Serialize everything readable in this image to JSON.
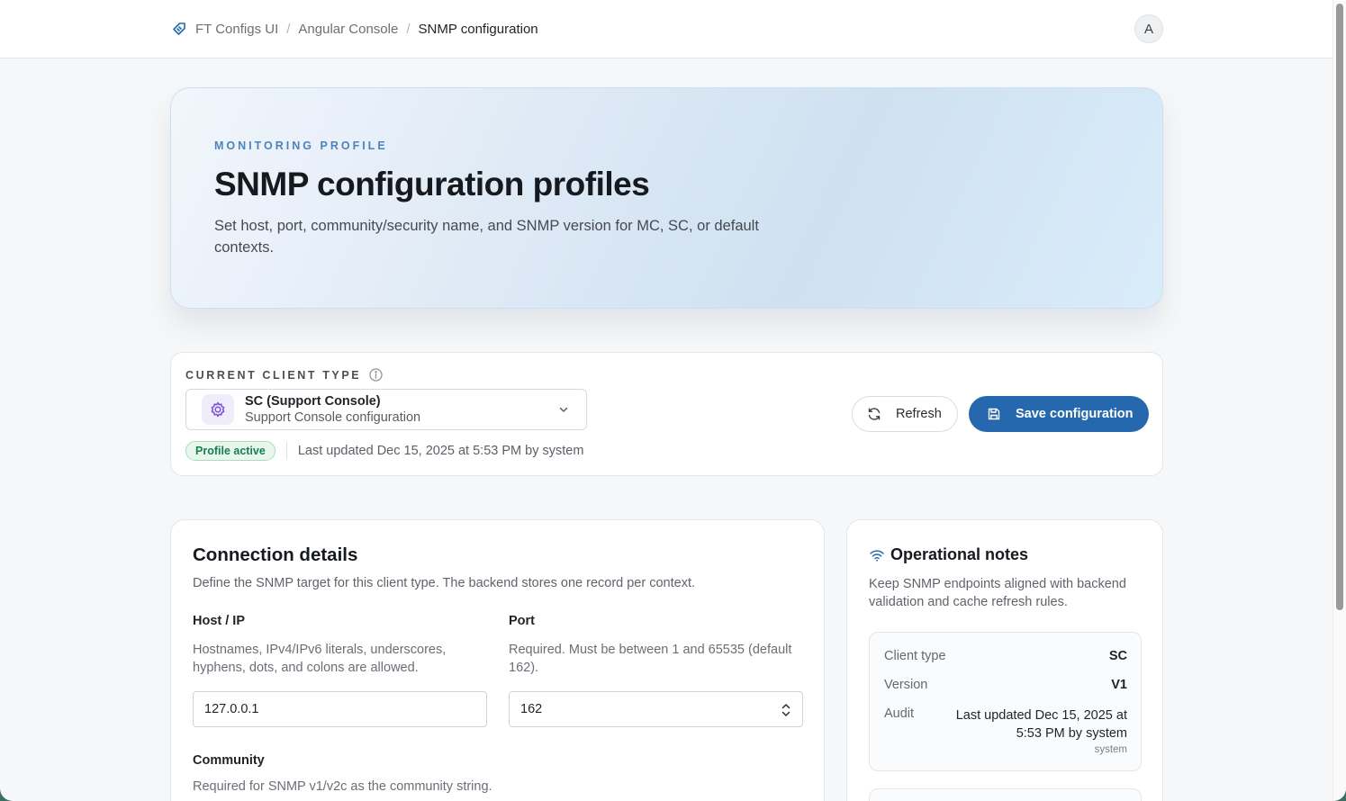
{
  "breadcrumb": {
    "app": "FT Configs UI",
    "section": "Angular Console",
    "current": "SNMP configuration"
  },
  "avatar": {
    "initial": "A"
  },
  "hero": {
    "eyebrow": "MONITORING PROFILE",
    "title": "SNMP configuration profiles",
    "description": "Set host, port, community/security name, and SNMP version for MC, SC, or default contexts."
  },
  "client": {
    "label": "CURRENT CLIENT TYPE",
    "selected_title": "SC (Support Console)",
    "selected_subtitle": "Support Console configuration",
    "status_badge": "Profile active",
    "last_updated": "Last updated Dec 15, 2025 at 5:53 PM by system",
    "refresh_label": "Refresh",
    "save_label": "Save configuration"
  },
  "connection": {
    "title": "Connection details",
    "description": "Define the SNMP target for this client type. The backend stores one record per context.",
    "host": {
      "label": "Host / IP",
      "help": "Hostnames, IPv4/IPv6 literals, underscores, hyphens, dots, and colons are allowed.",
      "value": "127.0.0.1"
    },
    "port": {
      "label": "Port",
      "help": "Required. Must be between 1 and 65535 (default 162).",
      "value": "162"
    },
    "community": {
      "label": "Community",
      "help": "Required for SNMP v1/v2c as the community string."
    }
  },
  "notes": {
    "title": "Operational notes",
    "description": "Keep SNMP endpoints aligned with backend validation and cache refresh rules.",
    "client_type_key": "Client type",
    "client_type_value": "SC",
    "version_key": "Version",
    "version_value": "V1",
    "audit_key": "Audit",
    "audit_value": "Last updated Dec 15, 2025 at 5:53 PM by system",
    "audit_sub": "system"
  },
  "colors": {
    "primary": "#2568ad",
    "eyebrow": "#4e82bd",
    "success": "#17804d",
    "gear": "#7b4fd6"
  }
}
